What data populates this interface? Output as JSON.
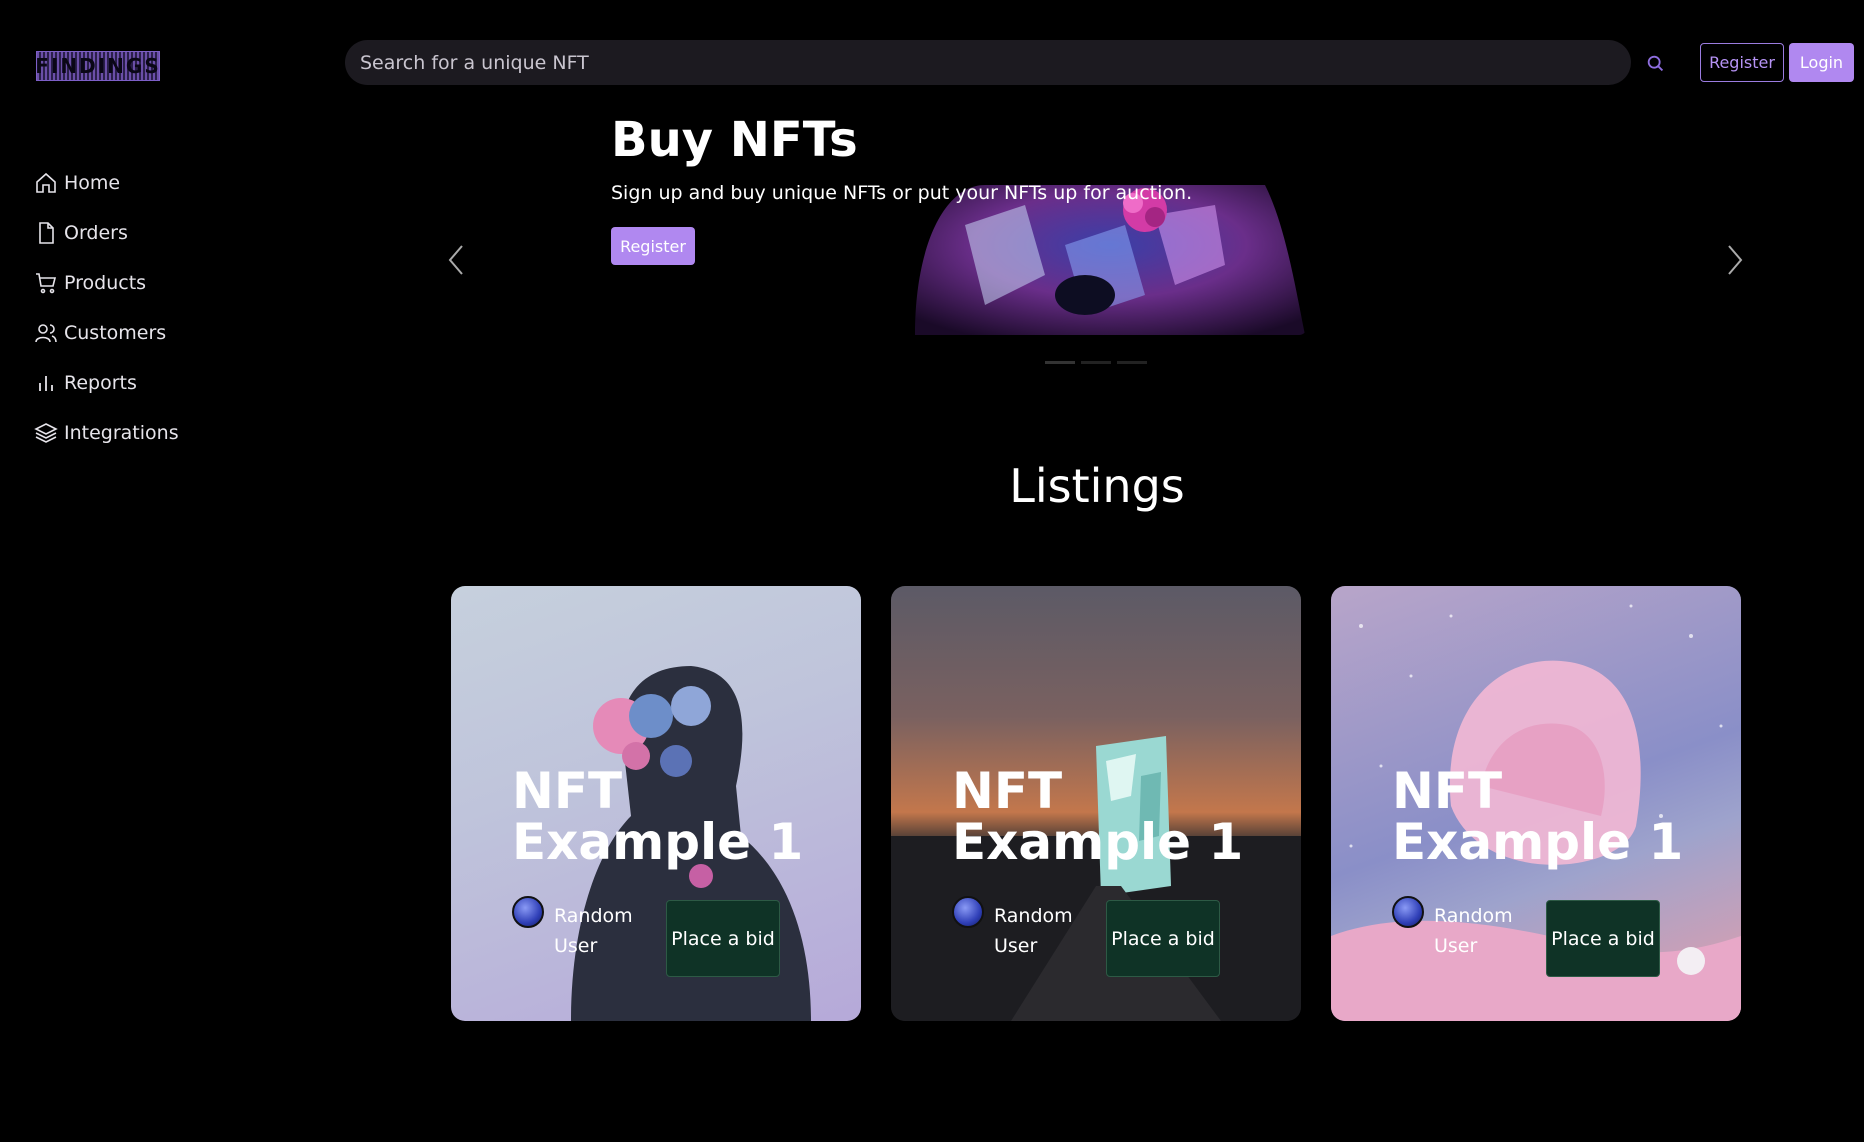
{
  "header": {
    "logo_text": "FINDINGS",
    "search_placeholder": "Search for a unique NFT",
    "register_label": "Register",
    "login_label": "Login"
  },
  "sidebar": {
    "items": [
      {
        "label": "Home",
        "icon": "home-icon"
      },
      {
        "label": "Orders",
        "icon": "file-icon"
      },
      {
        "label": "Products",
        "icon": "cart-icon"
      },
      {
        "label": "Customers",
        "icon": "users-icon"
      },
      {
        "label": "Reports",
        "icon": "bar-chart-icon"
      },
      {
        "label": "Integrations",
        "icon": "layers-icon"
      }
    ]
  },
  "hero": {
    "title": "Buy NFTs",
    "subtitle": "Sign up and buy unique NFTs or put your NFTs up for auction.",
    "button_label": "Register"
  },
  "listings": {
    "title": "Listings",
    "cards": [
      {
        "title": "NFT Example 1",
        "user": "Random User",
        "bid_label": "Place a bid"
      },
      {
        "title": "NFT Example 1",
        "user": "Random User",
        "bid_label": "Place a bid"
      },
      {
        "title": "NFT Example 1",
        "user": "Random User",
        "bid_label": "Place a bid"
      }
    ]
  },
  "colors": {
    "accent": "#b088f0",
    "bid_button": "#0f3326",
    "background": "#000000",
    "search_bg": "#1c1a20"
  }
}
